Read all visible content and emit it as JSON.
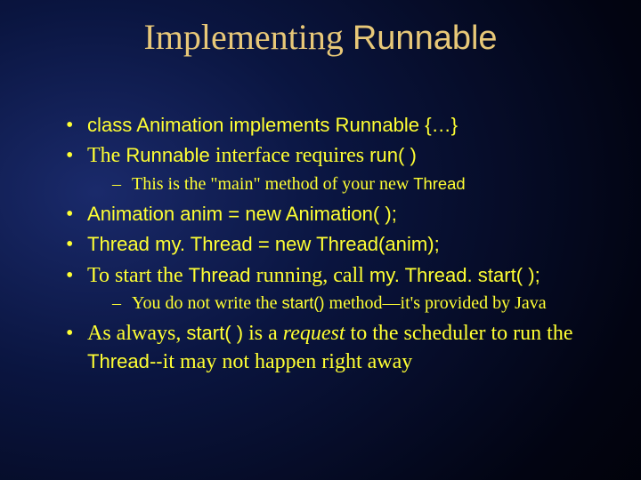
{
  "title": {
    "pre": "Implementing ",
    "kw": "Runnable"
  },
  "b1": {
    "text": "class Animation implements Runnable {…}"
  },
  "b2": {
    "p1": "The ",
    "kw1": "Runnable",
    "p2": " interface requires ",
    "kw2": "run( )"
  },
  "b2s1": {
    "p1": "This is the \"main\" method of your new ",
    "kw": "Thread"
  },
  "b3": {
    "text": "Animation anim = new Animation( );"
  },
  "b4": {
    "text": "Thread my. Thread = new Thread(anim);"
  },
  "b5": {
    "p1": "To start the ",
    "kw1": "Thread",
    "p2": " running, call ",
    "kw2": "my. Thread. start( );"
  },
  "b5s1": {
    "p1": "You do not write the ",
    "kw": "start()",
    "p2": " method—it's provided by Java"
  },
  "b6": {
    "p1": "As always, ",
    "kw1": "start( )",
    "p2": " is a ",
    "em": "request",
    "p3": " to the scheduler to run the ",
    "kw2": "Thread--",
    "p4": "it may not happen right away"
  }
}
